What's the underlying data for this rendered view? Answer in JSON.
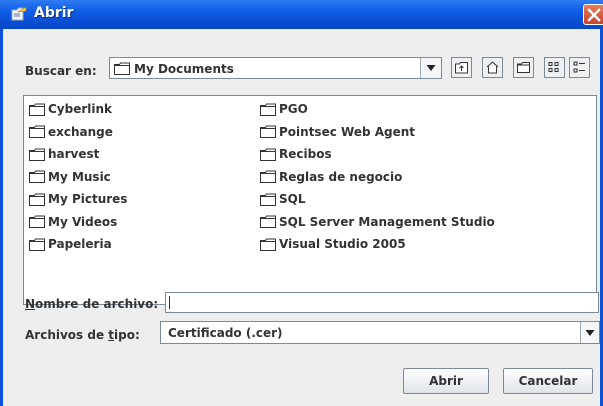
{
  "window": {
    "title": "Abrir"
  },
  "look_in": {
    "label": "Buscar en:",
    "value": "My Documents"
  },
  "toolbar": {
    "icons": [
      "up-one-level-icon",
      "home-icon",
      "new-folder-icon",
      "list-view-icon",
      "details-view-icon"
    ]
  },
  "files": {
    "col1": [
      "Cyberlink",
      "exchange",
      "harvest",
      "My Music",
      "My Pictures",
      "My Videos",
      "Papeleria"
    ],
    "col2": [
      "PGO",
      "Pointsec Web Agent",
      "Recibos",
      "Reglas de negocio",
      "SQL",
      "SQL Server Management Studio",
      "Visual Studio 2005"
    ]
  },
  "file_name": {
    "label_mnemonic": "N",
    "label_rest": "ombre de archivo:",
    "value": ""
  },
  "file_type": {
    "label_pre": "Archivos de ",
    "label_mnemonic": "t",
    "label_post": "ipo:",
    "value": "Certificado (.cer)"
  },
  "buttons": {
    "open": "Abrir",
    "cancel": "Cancelar"
  },
  "colors": {
    "titlebar": "#0a53d8",
    "panel": "#eeeeee",
    "close": "#c8432a"
  }
}
